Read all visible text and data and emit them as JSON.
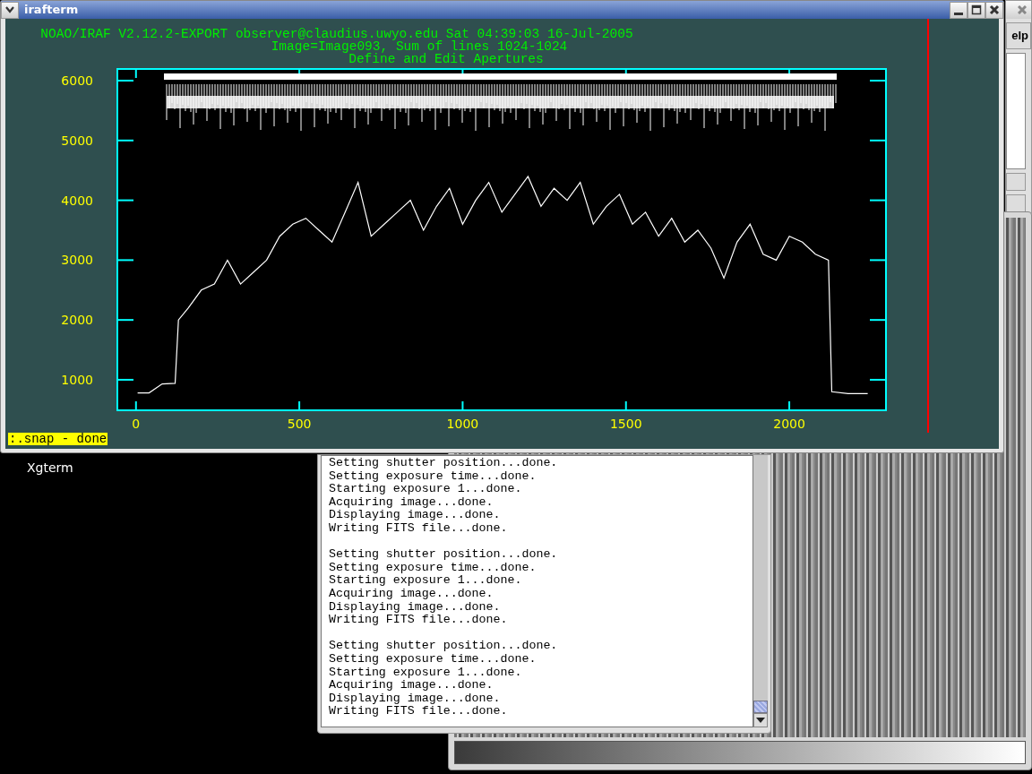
{
  "desktop": {
    "icon_label": "Xgterm"
  },
  "irafterm": {
    "title": "irafterm",
    "header_lines": [
      "NOAO/IRAF V2.12.2-EXPORT observer@claudius.uwyo.edu Sat 04:39:03 16-Jul-2005",
      "Image=Image093, Sum of lines 1024-1024",
      "Define and Edit Apertures"
    ],
    "chart_data": {
      "type": "line",
      "xlim": [
        -57,
        2296
      ],
      "ylim": [
        490,
        6195
      ],
      "xticks": [
        0,
        500,
        1000,
        1500,
        2000
      ],
      "yticks": [
        1000,
        2000,
        3000,
        4000,
        5000,
        6000
      ],
      "x": [
        5,
        40,
        80,
        120,
        130,
        160,
        200,
        240,
        280,
        320,
        360,
        400,
        440,
        480,
        520,
        560,
        600,
        640,
        680,
        720,
        760,
        800,
        840,
        880,
        920,
        960,
        1000,
        1040,
        1080,
        1120,
        1160,
        1200,
        1240,
        1280,
        1320,
        1360,
        1400,
        1440,
        1480,
        1520,
        1560,
        1600,
        1640,
        1680,
        1720,
        1760,
        1800,
        1840,
        1880,
        1920,
        1960,
        2000,
        2040,
        2080,
        2120,
        2130,
        2180,
        2240
      ],
      "series": [
        {
          "color": "#ffffff",
          "values": [
            780,
            780,
            930,
            940,
            2000,
            2200,
            2500,
            2600,
            3000,
            2600,
            2800,
            3000,
            3400,
            3600,
            3700,
            3500,
            3300,
            3800,
            4300,
            3400,
            3600,
            3800,
            4000,
            3500,
            3900,
            4200,
            3600,
            4000,
            4300,
            3800,
            4100,
            4400,
            3900,
            4200,
            4000,
            4300,
            3600,
            3900,
            4100,
            3600,
            3800,
            3400,
            3700,
            3300,
            3500,
            3200,
            2700,
            3300,
            3600,
            3100,
            3000,
            3400,
            3300,
            3100,
            3000,
            800,
            770,
            770
          ]
        }
      ]
    },
    "status": ":.snap -  done"
  },
  "log_window": {
    "blocks": [
      [
        "Setting shutter position...done.",
        "Setting exposure time...done.",
        "Starting exposure 1...done.",
        "Acquiring image...done.",
        "Displaying image...done.",
        "Writing FITS file...done."
      ],
      [
        "Setting shutter position...done.",
        "Setting exposure time...done.",
        "Starting exposure 1...done.",
        "Acquiring image...done.",
        "Displaying image...done.",
        "Writing FITS file...done."
      ],
      [
        "Setting shutter position...done.",
        "Setting exposure time...done.",
        "Starting exposure 1...done.",
        "Acquiring image...done.",
        "Displaying image...done.",
        "Writing FITS file...done."
      ]
    ]
  },
  "back_window": {
    "button_label": "elp"
  }
}
